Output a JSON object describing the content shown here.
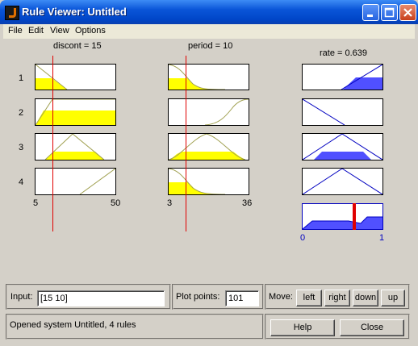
{
  "window": {
    "title": "Rule Viewer: Untitled"
  },
  "menu": [
    "File",
    "Edit",
    "View",
    "Options"
  ],
  "inputs": [
    {
      "name_label": "discont = 15",
      "range_min": "5",
      "range_max": "50"
    },
    {
      "name_label": "period = 10",
      "range_min": "3",
      "range_max": "36"
    }
  ],
  "output": {
    "name_label": "rate = 0.639",
    "range_min": "0",
    "range_max": "1",
    "value": 0.639
  },
  "rules": [
    "1",
    "2",
    "3",
    "4"
  ],
  "controls": {
    "input_label": "Input:",
    "input_value": "[15 10]",
    "plot_points_label": "Plot points:",
    "plot_points_value": "101",
    "move_label": "Move:",
    "left": "left",
    "right": "right",
    "down": "down",
    "up": "up",
    "help": "Help",
    "close": "Close"
  },
  "status": "Opened system Untitled, 4 rules",
  "colors": {
    "input_fill": "#ffff00",
    "output_fill": "#5050ff",
    "mf_line_input": "#a0a050",
    "mf_line_output": "#0000c0",
    "indicator": "#e00000"
  }
}
